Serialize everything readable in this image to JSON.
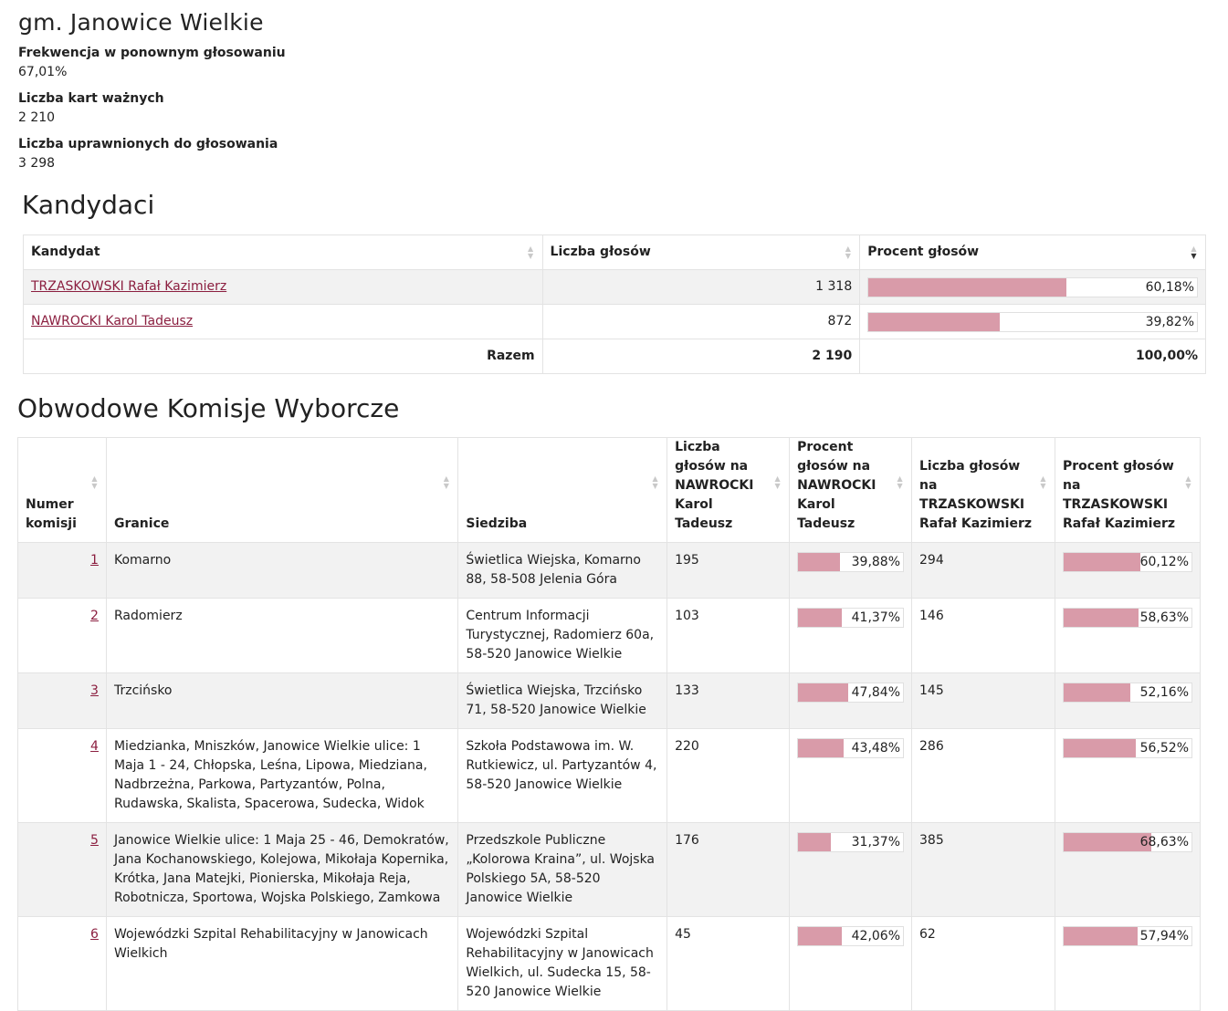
{
  "header": {
    "title": "gm. Janowice Wielkie",
    "stats": [
      {
        "label": "Frekwencja w ponownym głosowaniu",
        "value": "67,01%"
      },
      {
        "label": "Liczba kart ważnych",
        "value": "2 210"
      },
      {
        "label": "Liczba uprawnionych do głosowania",
        "value": "3 298"
      }
    ]
  },
  "candidates": {
    "section_title": "Kandydaci",
    "columns": [
      "Kandydat",
      "Liczba głosów",
      "Procent głosów"
    ],
    "rows": [
      {
        "name": "TRZASKOWSKI Rafał Kazimierz",
        "votes": "1 318",
        "percent": "60,18%",
        "fraction": 0.6018
      },
      {
        "name": "NAWROCKI Karol Tadeusz",
        "votes": "872",
        "percent": "39,82%",
        "fraction": 0.3982
      }
    ],
    "total": {
      "label": "Razem",
      "votes": "2 190",
      "percent": "100,00%"
    }
  },
  "commissions": {
    "section_title": "Obwodowe Komisje Wyborcze",
    "columns": [
      "Numer komisji",
      "Granice",
      "Siedziba",
      "Liczba głosów na NAWROCKI Karol Tadeusz",
      "Procent głosów na NAWROCKI Karol Tadeusz",
      "Liczba głosów na TRZASKOWSKI Rafał Kazimierz",
      "Procent głosów na TRZASKOWSKI Rafał Kazimierz"
    ],
    "rows": [
      {
        "no": "1",
        "granice": "Komarno",
        "siedziba": "Świetlica Wiejska, Komarno 88, 58-508 Jelenia Góra",
        "n_votes": "195",
        "n_pct": "39,88%",
        "n_frac": 0.3988,
        "t_votes": "294",
        "t_pct": "60,12%",
        "t_frac": 0.6012
      },
      {
        "no": "2",
        "granice": "Radomierz",
        "siedziba": "Centrum Informacji Turystycznej, Radomierz 60a, 58-520 Janowice Wielkie",
        "n_votes": "103",
        "n_pct": "41,37%",
        "n_frac": 0.4137,
        "t_votes": "146",
        "t_pct": "58,63%",
        "t_frac": 0.5863
      },
      {
        "no": "3",
        "granice": "Trzcińsko",
        "siedziba": "Świetlica Wiejska, Trzcińsko 71, 58-520 Janowice Wielkie",
        "n_votes": "133",
        "n_pct": "47,84%",
        "n_frac": 0.4784,
        "t_votes": "145",
        "t_pct": "52,16%",
        "t_frac": 0.5216
      },
      {
        "no": "4",
        "granice": "Miedzianka, Mniszków, Janowice Wielkie ulice: 1 Maja 1 - 24, Chłopska, Leśna, Lipowa, Miedziana, Nadbrzeżna, Parkowa, Partyzantów, Polna, Rudawska, Skalista, Spacerowa, Sudecka, Widok",
        "siedziba": "Szkoła Podstawowa im. W. Rutkiewicz, ul. Partyzantów 4, 58-520 Janowice Wielkie",
        "n_votes": "220",
        "n_pct": "43,48%",
        "n_frac": 0.4348,
        "t_votes": "286",
        "t_pct": "56,52%",
        "t_frac": 0.5652
      },
      {
        "no": "5",
        "granice": "Janowice Wielkie ulice: 1 Maja 25 - 46, Demokratów, Jana Kochanowskiego, Kolejowa, Mikołaja Kopernika, Krótka, Jana Matejki, Pionierska, Mikołaja Reja, Robotnicza, Sportowa, Wojska Polskiego, Zamkowa",
        "siedziba": "Przedszkole Publiczne „Kolorowa Kraina”, ul. Wojska Polskiego 5A, 58-520 Janowice Wielkie",
        "n_votes": "176",
        "n_pct": "31,37%",
        "n_frac": 0.3137,
        "t_votes": "385",
        "t_pct": "68,63%",
        "t_frac": 0.6863
      },
      {
        "no": "6",
        "granice": "Wojewódzki Szpital Rehabilitacyjny w Janowicach Wielkich",
        "siedziba": "Wojewódzki Szpital Rehabilitacyjny w Janowicach Wielkich, ul. Sudecka 15, 58-520 Janowice Wielkie",
        "n_votes": "45",
        "n_pct": "42,06%",
        "n_frac": 0.4206,
        "t_votes": "62",
        "t_pct": "57,94%",
        "t_frac": 0.5794
      }
    ]
  },
  "colors": {
    "bar_fill": "#d99ba9",
    "link": "#8b1e3f",
    "row_shade": "#f2f2f2"
  }
}
